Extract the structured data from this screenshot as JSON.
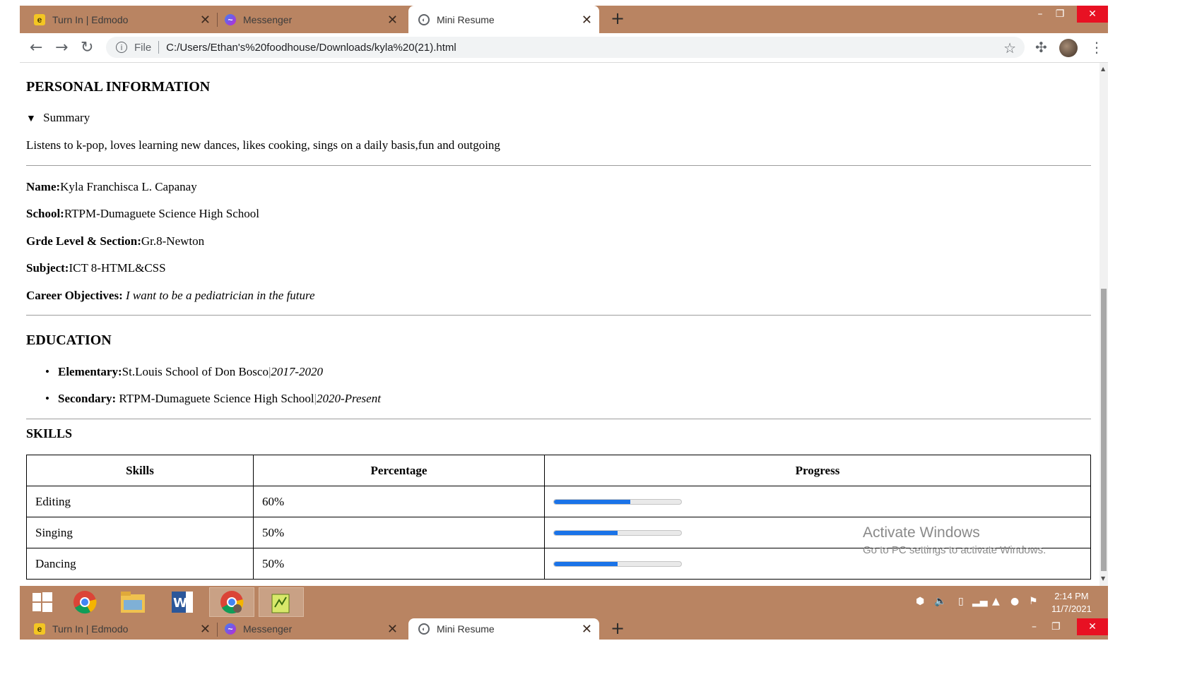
{
  "browser": {
    "tabs": [
      {
        "title": "Turn In | Edmodo",
        "icon": "edmodo-icon",
        "active": false
      },
      {
        "title": "Messenger",
        "icon": "messenger-icon",
        "active": false
      },
      {
        "title": "Mini Resume",
        "icon": "globe-icon",
        "active": true
      }
    ],
    "omnibox": {
      "scheme_label": "File",
      "url": "C:/Users/Ethan's%20foodhouse/Downloads/kyla%20(21).html"
    }
  },
  "resume": {
    "personal_heading": "PERSONAL INFORMATION",
    "summary_label": "Summary",
    "summary_text": "Listens to k-pop, loves learning new dances, likes cooking, sings on a daily basis,fun and outgoing",
    "fields": {
      "name_label": "Name:",
      "name_value": "Kyla Franchisca L. Capanay",
      "school_label": "School:",
      "school_value": "RTPM-Dumaguete Science High School",
      "grade_label": "Grde Level & Section:",
      "grade_value": "Gr.8-Newton",
      "subject_label": "Subject:",
      "subject_value": "ICT 8-HTML&CSS",
      "career_label": "Career Objectives:",
      "career_value": "I want to be a pediatrician in the future"
    },
    "education_heading": "EDUCATION",
    "education": [
      {
        "level": "Elementary:",
        "school": "St.Louis School of Don Bosco",
        "sep": "|",
        "years": "2017-2020"
      },
      {
        "level": "Secondary:",
        "school": " RTPM-Dumaguete Science High School",
        "sep": "|",
        "years": "2020-Present"
      }
    ],
    "skills_heading": "SKILLS",
    "skills_table": {
      "headers": [
        "Skills",
        "Percentage",
        "Progress"
      ],
      "rows": [
        {
          "skill": "Editing",
          "percentage": "60%",
          "progress": 0.6
        },
        {
          "skill": "Singing",
          "percentage": "50%",
          "progress": 0.5
        },
        {
          "skill": "Dancing",
          "percentage": "50%",
          "progress": 0.5
        }
      ]
    }
  },
  "watermark": {
    "line1": "Activate Windows",
    "line2": "Go to PC settings to activate Windows."
  },
  "taskbar": {
    "apps": [
      "windows-start-icon",
      "chrome-icon",
      "file-explorer-icon",
      "word-icon",
      "chrome-active-icon",
      "notepad-plus-icon"
    ],
    "clock_time": "2:14 PM",
    "clock_date": "11/7/2021"
  },
  "colors": {
    "chrome_frame": "#b98462",
    "progress_fill": "#1a73e8",
    "close_red": "#e81123"
  }
}
